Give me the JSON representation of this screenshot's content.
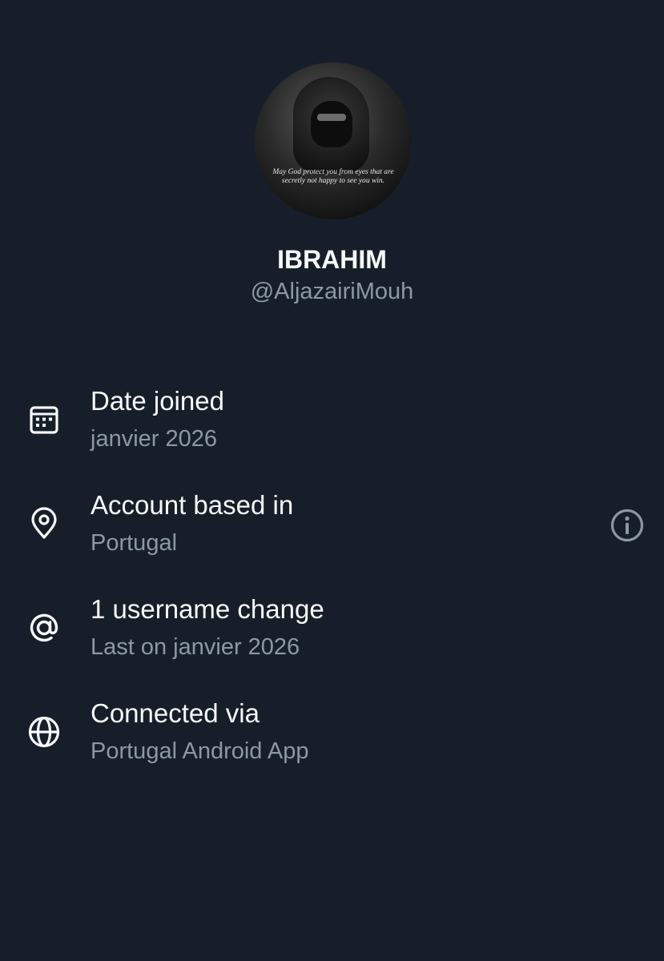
{
  "profile": {
    "display_name": "IBRAHIM",
    "handle": "@AljazairiMouh",
    "avatar_caption": "May God protect you from eyes that are secretly not happy to see you win."
  },
  "details": [
    {
      "icon": "calendar-icon",
      "title": "Date joined",
      "subtitle": "janvier 2026"
    },
    {
      "icon": "location-pin-icon",
      "title": "Account based in",
      "subtitle": "Portugal",
      "action_icon": "info-icon"
    },
    {
      "icon": "at-sign-icon",
      "title": "1 username change",
      "subtitle": "Last on janvier 2026"
    },
    {
      "icon": "globe-icon",
      "title": "Connected via",
      "subtitle": "Portugal Android App"
    }
  ],
  "colors": {
    "background": "#161f29",
    "primary_text": "#f7f9f9",
    "secondary_text": "#8b98a5"
  }
}
